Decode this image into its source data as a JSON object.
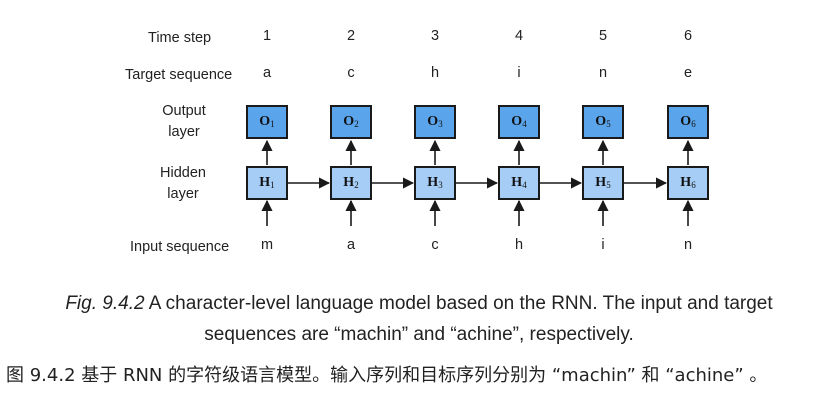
{
  "rows": {
    "time_step": "Time step",
    "target_sequence": "Target sequence",
    "output_layer_line1": "Output",
    "output_layer_line2": "layer",
    "hidden_layer_line1": "Hidden",
    "hidden_layer_line2": "layer",
    "input_sequence": "Input sequence"
  },
  "steps": [
    {
      "t": "1",
      "target": "a",
      "input": "m",
      "o": "O",
      "h": "H",
      "sub": "1"
    },
    {
      "t": "2",
      "target": "c",
      "input": "a",
      "o": "O",
      "h": "H",
      "sub": "2"
    },
    {
      "t": "3",
      "target": "h",
      "input": "c",
      "o": "O",
      "h": "H",
      "sub": "3"
    },
    {
      "t": "4",
      "target": "i",
      "input": "h",
      "o": "O",
      "h": "H",
      "sub": "4"
    },
    {
      "t": "5",
      "target": "n",
      "input": "i",
      "o": "O",
      "h": "H",
      "sub": "5"
    },
    {
      "t": "6",
      "target": "e",
      "input": "n",
      "o": "O",
      "h": "H",
      "sub": "6"
    }
  ],
  "caption": {
    "fig_label": "Fig. 9.4.2",
    "text_line1": " A character-level language model based on the RNN. The input and target",
    "text_line2": "sequences are “machin” and “achine”, respectively.",
    "chinese": "图 9.4.2 基于 RNN 的字符级语言模型。输入序列和目标序列分别为 “machin” 和 “achine” 。"
  },
  "colors": {
    "output_node": "#5aa4ec",
    "hidden_node": "#a6cdf6",
    "stroke": "#1a1a1a"
  }
}
